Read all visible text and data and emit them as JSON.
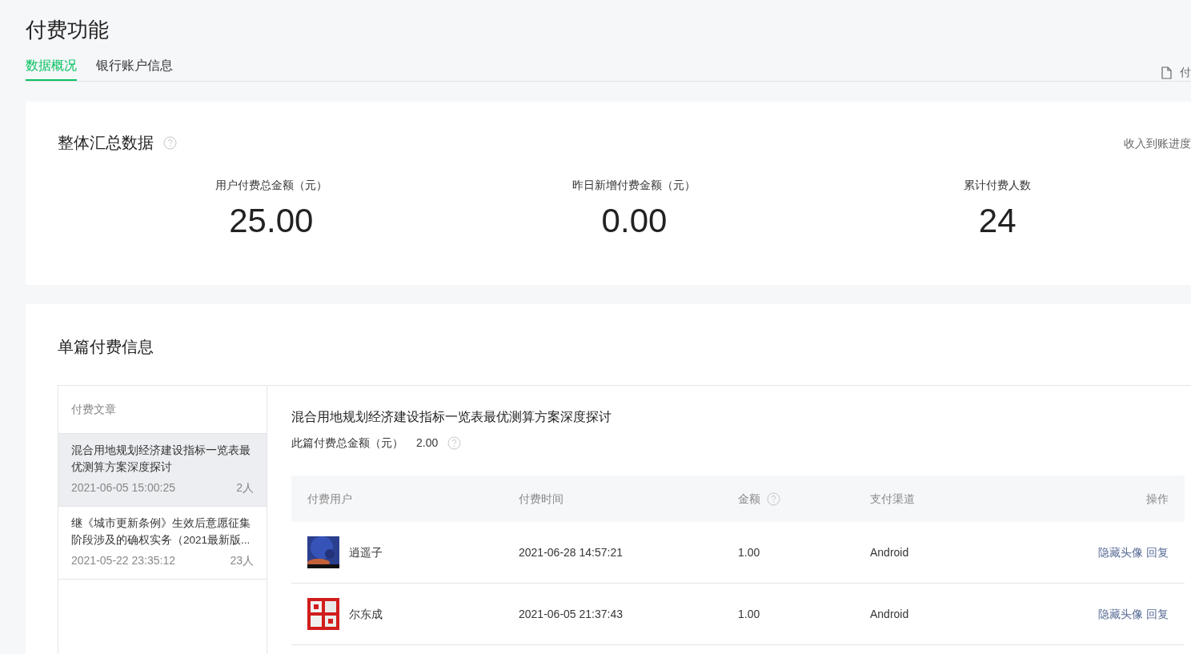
{
  "page_title": "付费功能",
  "tabs": [
    {
      "label": "数据概况",
      "selected": true
    },
    {
      "label": "银行账户信息",
      "selected": false
    }
  ],
  "top_right_link": "付",
  "summary": {
    "title": "整体汇总数据",
    "link": "收入到账进度",
    "stats": [
      {
        "label": "用户付费总金额（元）",
        "value": "25.00"
      },
      {
        "label": "昨日新增付费金额（元）",
        "value": "0.00"
      },
      {
        "label": "累计付费人数",
        "value": "24"
      }
    ]
  },
  "articles_section": {
    "title": "单篇付费信息",
    "list_header": "付费文章",
    "articles": [
      {
        "title": "混合用地规划经济建设指标一览表最优测算方案深度探讨",
        "time": "2021-06-05 15:00:25",
        "count": "2人",
        "selected": true
      },
      {
        "title": "继《城市更新条例》生效后意愿征集阶段涉及的确权实务（2021最新版...",
        "time": "2021-05-22 23:35:12",
        "count": "23人",
        "selected": false
      }
    ],
    "detail": {
      "title": "混合用地规划经济建设指标一览表最优测算方案深度探讨",
      "total_label": "此篇付费总金额（元）",
      "total_value": "2.00",
      "columns": [
        "付费用户",
        "付费时间",
        "金额",
        "支付渠道",
        "操作"
      ],
      "rows": [
        {
          "avatar": {
            "kind": "picture"
          },
          "user": "逍遥子",
          "time": "2021-06-28 14:57:21",
          "amount": "1.00",
          "channel": "Android",
          "actions": [
            "隐藏头像",
            "回复"
          ]
        },
        {
          "avatar": {
            "kind": "picture"
          },
          "user": "尔东成",
          "time": "2021-06-05 21:37:43",
          "amount": "1.00",
          "channel": "Android",
          "actions": [
            "隐藏头像",
            "回复"
          ]
        }
      ]
    }
  }
}
